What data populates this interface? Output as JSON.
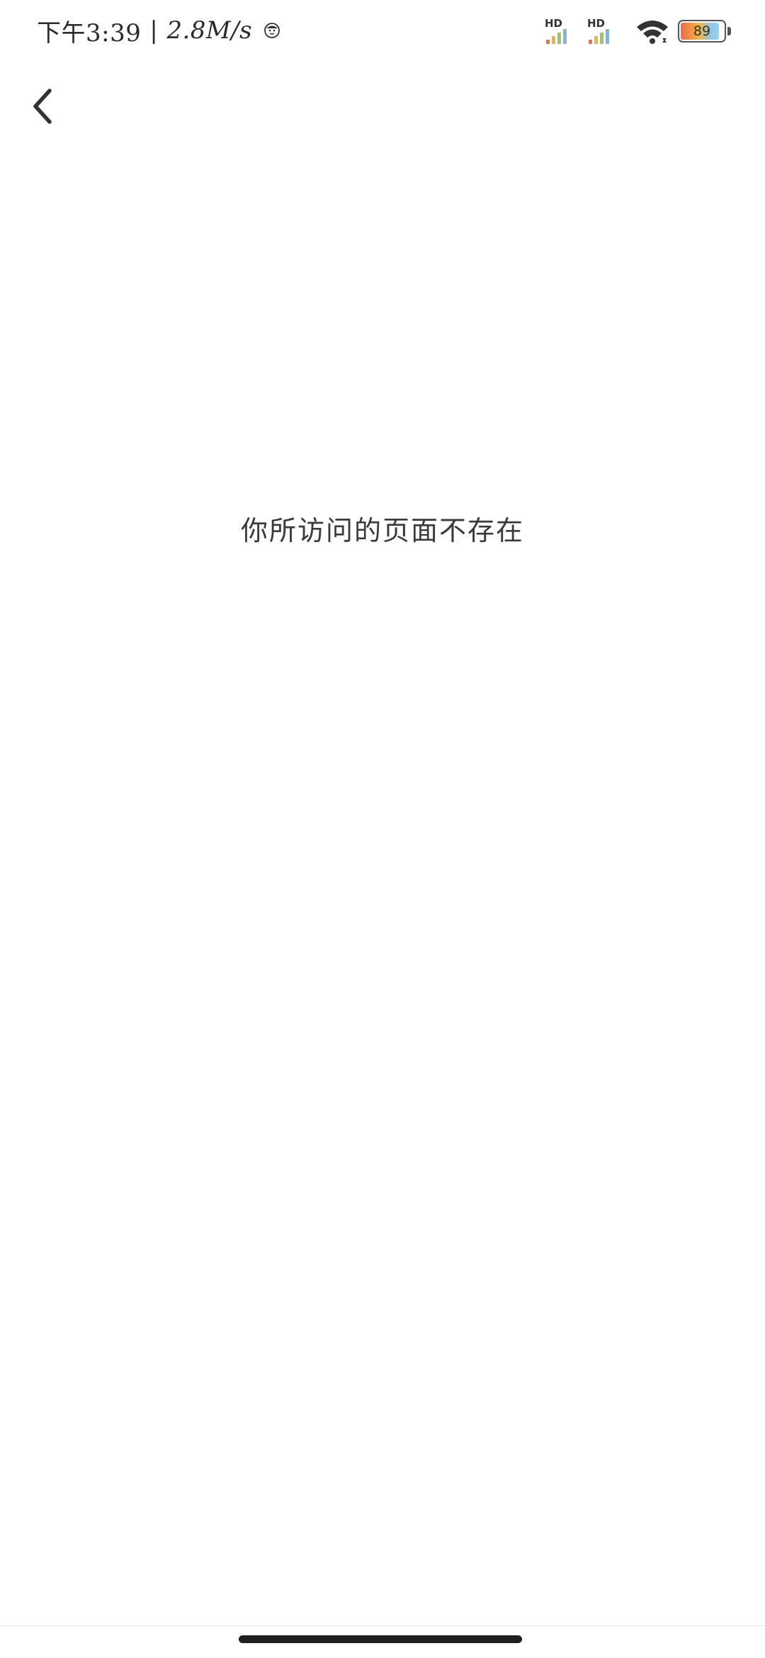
{
  "status_bar": {
    "time": "下午3:39",
    "separator": "|",
    "network_speed": "2.8M/s",
    "sim1_label": "HD",
    "sim2_label": "HD",
    "battery_level": "89",
    "battery_fraction": 0.89,
    "icons": [
      "face-icon",
      "signal-icon",
      "signal-icon",
      "wifi-icon",
      "battery-icon"
    ]
  },
  "nav": {
    "back_icon": "chevron-left-icon"
  },
  "main": {
    "message": "你所访问的页面不存在"
  },
  "colors": {
    "background": "#ffffff",
    "text": "#3a3a3a",
    "home_indicator": "#1f1f1f"
  }
}
